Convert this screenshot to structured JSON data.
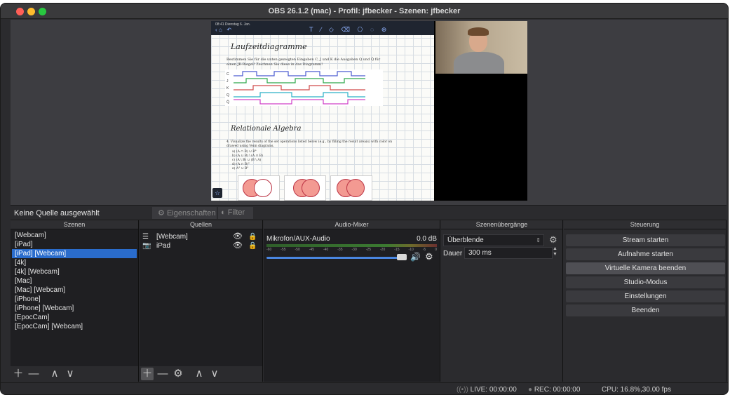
{
  "window": {
    "title": "OBS 26.1.2 (mac) - Profil: jfbecker - Szenen: jfbecker"
  },
  "preview": {
    "ipad_date": "08:41  Dienstag 6. Jan.",
    "ipad_tools": "T ∕ ◇ ⌫ ⎔ ◌ ⊕",
    "heading_1": "Laufzeitdiagramme",
    "task_text": "Bestimmen Sie für die unten gezeigten Eingaben C, J und K die Ausgaben Q und Q̄ für einen JK-Riegel! Zeichnen Sie diese in das Diagramm!",
    "signal_labels": [
      "C",
      "J",
      "K",
      "Q",
      "Q̄"
    ],
    "heading_2": "Relationale Algebra",
    "venn_text": "4. Visualize the results of the set operations listed below (e.g., by filling the result area(s) with color on drawed using Venn diagrams.",
    "venn_items": [
      "a) (A ∩ B) ∪ B°",
      "b) (A ∪ B) \\ (A ∩ B)",
      "c) (A \\ B) ∪ (B \\ A)",
      "d) (A ∩ B)°",
      "e) A° ∪ B°"
    ]
  },
  "source_bar": {
    "no_source": "Keine Quelle ausgewählt",
    "properties": "Eigenschaften",
    "filter": "Filter"
  },
  "docks": {
    "scenes_title": "Szenen",
    "sources_title": "Quellen",
    "mixer_title": "Audio-Mixer",
    "transitions_title": "Szenenübergänge",
    "controls_title": "Steuerung"
  },
  "scenes": [
    "[Webcam]",
    "[iPad]",
    "[iPad] [Webcam]",
    "[4k]",
    "[4k] [Webcam]",
    "[Mac]",
    "[Mac] [Webcam]",
    "[iPhone]",
    "[iPhone] [Webcam]",
    "[EpocCam]",
    "[EpocCam] [Webcam]"
  ],
  "selected_scene": "[iPad] [Webcam]",
  "sources": [
    {
      "name": "[Webcam]",
      "icon": "list-icon",
      "visible": true,
      "locked": true
    },
    {
      "name": "iPad",
      "icon": "camera-icon",
      "visible": true,
      "locked": true
    }
  ],
  "mixer": {
    "channel": "Mikrofon/AUX-Audio",
    "db": "0.0 dB",
    "ticks": [
      "-60",
      "-55",
      "-50",
      "-45",
      "-40",
      "-35",
      "-30",
      "-25",
      "-20",
      "-15",
      "-10",
      "-5",
      "0"
    ],
    "volume_level": 0.95
  },
  "transitions": {
    "selected": "Überblende",
    "dauer_label": "Dauer",
    "dauer_value": "300 ms"
  },
  "controls": {
    "stream": "Stream starten",
    "record": "Aufnahme starten",
    "virtual_cam": "Virtuelle Kamera beenden",
    "studio": "Studio-Modus",
    "settings": "Einstellungen",
    "quit": "Beenden"
  },
  "status": {
    "live": "LIVE: 00:00:00",
    "rec": "REC: 00:00:00",
    "cpu": "CPU: 16.8%,30.00 fps"
  }
}
